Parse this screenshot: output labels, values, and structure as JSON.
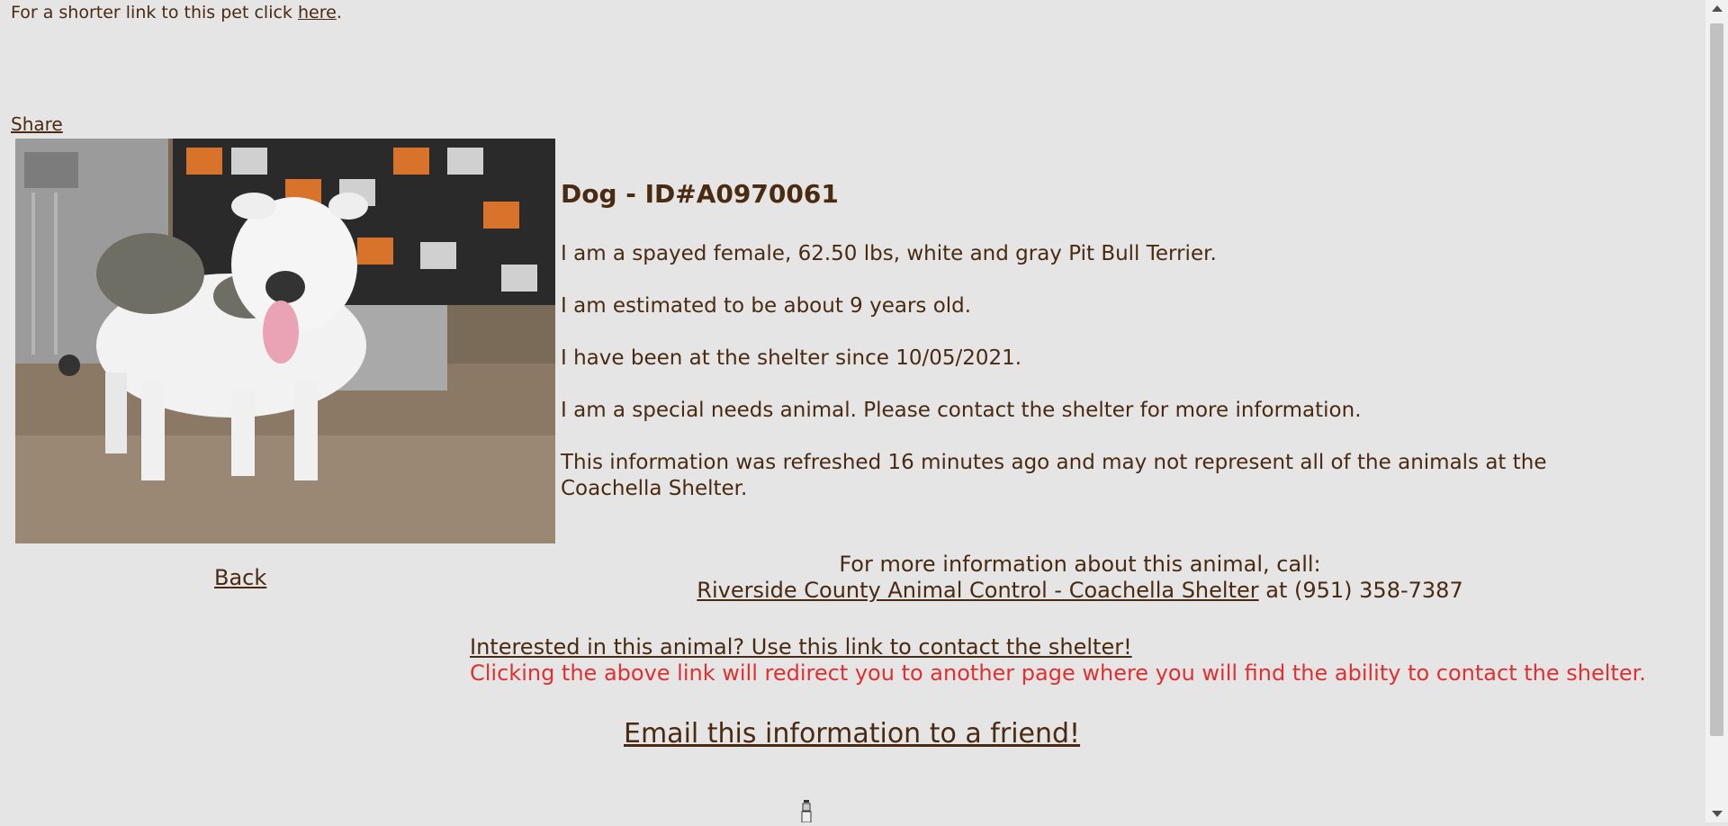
{
  "shortlink": {
    "prefix": "For a shorter link to this pet click ",
    "link": "here",
    "suffix": "."
  },
  "share_label": "Share",
  "animal": {
    "title": "Dog - ID#A0970061",
    "desc_1": "I am a spayed female, 62.50 lbs, white and gray Pit Bull Terrier.",
    "desc_2": "I am estimated to be about 9 years old.",
    "desc_3": "I have been at the shelter since 10/05/2021.",
    "desc_4": "I am a special needs animal. Please contact the shelter for more information.",
    "desc_5": "This information was refreshed 16 minutes ago and may not represent all of the animals at the Coachella Shelter."
  },
  "back_label": "Back",
  "contact": {
    "intro": "For more information about this animal, call:",
    "shelter_link": "Riverside County Animal Control - Coachella Shelter",
    "phone_text": " at (951) 358-7387"
  },
  "interested": {
    "link": "Interested in this animal? Use this link to contact the shelter!",
    "warning": "Clicking the above link will redirect you to another page where you will find the ability to contact the shelter."
  },
  "email_label": "Email this information to a friend!",
  "colors": {
    "background": "#e5e5e5",
    "text": "#4a2a10",
    "warning": "#e03030"
  }
}
